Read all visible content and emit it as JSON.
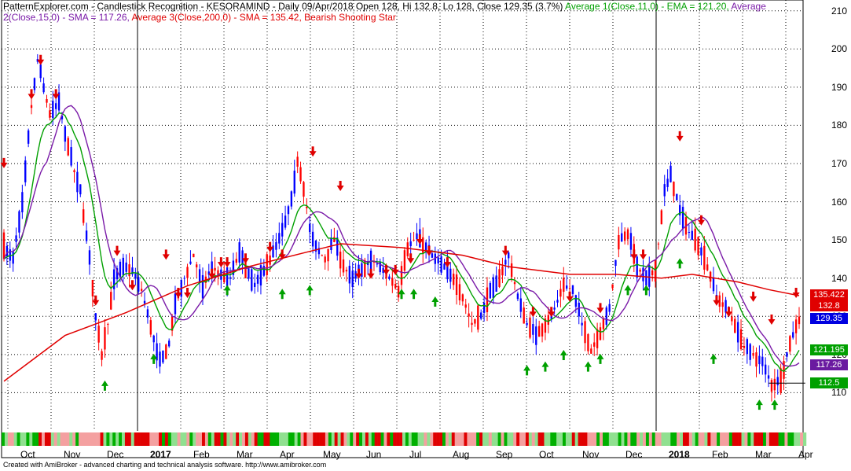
{
  "header": {
    "site": "PatternExplorer.com",
    "rest_black": " - Candlestick Recognition - KESORAMIND - Daily 09/Apr/2018 Open 128, Hi 132.8, Lo 128, Close 129.35 (3.7%) ",
    "avg1": "Average 1(Close,11,0) - EMA = 121.20,",
    "avg2": " Average 2(Close,15,0) - SMA = 117.26,",
    "avg3": " Average 3(Close,200,0) - SMA = 135.42,",
    "pattern": " Bearish Shooting Star"
  },
  "footer": "Created with AmiBroker - advanced charting and technical analysis software. http://www.amibroker.com",
  "colors": {
    "avg1": "#00a000",
    "avg2": "#7a1aa8",
    "avg3": "#e00000",
    "up_candle": "#0000ff",
    "down_candle": "#ff0000",
    "bull_arrow": "#00a000",
    "bear_arrow": "#e00000",
    "grid": "#000000"
  },
  "chart_data": {
    "type": "candlestick",
    "symbol": "KESORAMIND",
    "ylim": [
      100,
      212
    ],
    "y_ticks": [
      110,
      120,
      130,
      140,
      150,
      160,
      170,
      180,
      190,
      200,
      210
    ],
    "x_ticks": [
      {
        "label": "Oct",
        "bold": false
      },
      {
        "label": "Nov",
        "bold": false
      },
      {
        "label": "Dec",
        "bold": false
      },
      {
        "label": "2017",
        "bold": true
      },
      {
        "label": "Feb",
        "bold": false
      },
      {
        "label": "Mar",
        "bold": false
      },
      {
        "label": "Apr",
        "bold": false
      },
      {
        "label": "May",
        "bold": false
      },
      {
        "label": "Jun",
        "bold": false
      },
      {
        "label": "Jul",
        "bold": false
      },
      {
        "label": "Aug",
        "bold": false
      },
      {
        "label": "Sep",
        "bold": false
      },
      {
        "label": "Oct",
        "bold": false
      },
      {
        "label": "Nov",
        "bold": false
      },
      {
        "label": "Dec",
        "bold": false
      },
      {
        "label": "2018",
        "bold": true
      },
      {
        "label": "Feb",
        "bold": false
      },
      {
        "label": "Mar",
        "bold": false
      },
      {
        "label": "Apr",
        "bold": false
      }
    ],
    "price_path": [
      [
        0,
        148
      ],
      [
        3,
        145
      ],
      [
        6,
        160
      ],
      [
        9,
        185
      ],
      [
        11,
        197
      ],
      [
        13,
        190
      ],
      [
        15,
        183
      ],
      [
        18,
        186
      ],
      [
        20,
        178
      ],
      [
        23,
        168
      ],
      [
        25,
        163
      ],
      [
        28,
        145
      ],
      [
        30,
        130
      ],
      [
        32,
        120
      ],
      [
        34,
        128
      ],
      [
        36,
        140
      ],
      [
        39,
        143
      ],
      [
        42,
        142
      ],
      [
        45,
        137
      ],
      [
        48,
        127
      ],
      [
        51,
        118
      ],
      [
        54,
        123
      ],
      [
        56,
        133
      ],
      [
        59,
        140
      ],
      [
        62,
        146
      ],
      [
        65,
        138
      ],
      [
        68,
        143
      ],
      [
        71,
        141
      ],
      [
        74,
        140
      ],
      [
        77,
        147
      ],
      [
        79,
        143
      ],
      [
        82,
        138
      ],
      [
        85,
        142
      ],
      [
        87,
        145
      ],
      [
        90,
        150
      ],
      [
        92,
        155
      ],
      [
        94,
        160
      ],
      [
        96,
        171
      ],
      [
        98,
        164
      ],
      [
        100,
        153
      ],
      [
        102,
        148
      ],
      [
        105,
        145
      ],
      [
        108,
        150
      ],
      [
        111,
        143
      ],
      [
        114,
        140
      ],
      [
        117,
        142
      ],
      [
        120,
        145
      ],
      [
        123,
        143
      ],
      [
        126,
        140
      ],
      [
        129,
        137
      ],
      [
        132,
        148
      ],
      [
        135,
        151
      ],
      [
        138,
        148
      ],
      [
        141,
        145
      ],
      [
        144,
        143
      ],
      [
        147,
        140
      ],
      [
        150,
        135
      ],
      [
        153,
        128
      ],
      [
        156,
        130
      ],
      [
        159,
        136
      ],
      [
        162,
        140
      ],
      [
        165,
        146
      ],
      [
        168,
        135
      ],
      [
        171,
        128
      ],
      [
        174,
        125
      ],
      [
        177,
        128
      ],
      [
        180,
        132
      ],
      [
        183,
        138
      ],
      [
        186,
        137
      ],
      [
        189,
        128
      ],
      [
        192,
        121
      ],
      [
        195,
        126
      ],
      [
        198,
        132
      ],
      [
        201,
        150
      ],
      [
        204,
        152
      ],
      [
        207,
        143
      ],
      [
        210,
        140
      ],
      [
        213,
        142
      ],
      [
        216,
        163
      ],
      [
        218,
        167
      ],
      [
        221,
        158
      ],
      [
        224,
        152
      ],
      [
        227,
        149
      ],
      [
        230,
        143
      ],
      [
        233,
        135
      ],
      [
        236,
        132
      ],
      [
        239,
        128
      ],
      [
        242,
        122
      ],
      [
        245,
        120
      ],
      [
        248,
        118
      ],
      [
        251,
        112
      ],
      [
        254,
        113
      ],
      [
        256,
        120
      ],
      [
        258,
        125
      ],
      [
        260,
        129.35
      ]
    ],
    "avg3_path": [
      [
        0,
        113
      ],
      [
        20,
        125
      ],
      [
        40,
        131
      ],
      [
        60,
        138
      ],
      [
        80,
        143
      ],
      [
        100,
        147
      ],
      [
        110,
        149
      ],
      [
        130,
        148
      ],
      [
        150,
        146
      ],
      [
        165,
        143
      ],
      [
        185,
        141
      ],
      [
        200,
        141
      ],
      [
        215,
        140
      ],
      [
        225,
        141
      ],
      [
        240,
        139
      ],
      [
        250,
        137
      ],
      [
        260,
        135.42
      ]
    ],
    "bear_arrows": [
      [
        0,
        169
      ],
      [
        9,
        187
      ],
      [
        12,
        196
      ],
      [
        17,
        187
      ],
      [
        30,
        133
      ],
      [
        37,
        146
      ],
      [
        42,
        137
      ],
      [
        53,
        145
      ],
      [
        57,
        135
      ],
      [
        60,
        135
      ],
      [
        68,
        140
      ],
      [
        71,
        143
      ],
      [
        73,
        143
      ],
      [
        79,
        144
      ],
      [
        87,
        147
      ],
      [
        91,
        145
      ],
      [
        101,
        172
      ],
      [
        110,
        163
      ],
      [
        116,
        140
      ],
      [
        120,
        140
      ],
      [
        125,
        141
      ],
      [
        128,
        141
      ],
      [
        133,
        144
      ],
      [
        136,
        149
      ],
      [
        139,
        146
      ],
      [
        145,
        143
      ],
      [
        164,
        146
      ],
      [
        173,
        130
      ],
      [
        179,
        130
      ],
      [
        185,
        134
      ],
      [
        195,
        131
      ],
      [
        206,
        145
      ],
      [
        209,
        145
      ],
      [
        221,
        176
      ],
      [
        228,
        154
      ],
      [
        233,
        133
      ],
      [
        237,
        130
      ],
      [
        245,
        134
      ],
      [
        251,
        128
      ],
      [
        259,
        135
      ]
    ],
    "bull_arrows": [
      [
        33,
        113
      ],
      [
        49,
        120
      ],
      [
        73,
        138
      ],
      [
        91,
        137
      ],
      [
        100,
        138
      ],
      [
        130,
        137
      ],
      [
        134,
        137
      ],
      [
        141,
        135
      ],
      [
        171,
        117
      ],
      [
        177,
        118
      ],
      [
        183,
        121
      ],
      [
        191,
        118
      ],
      [
        195,
        120
      ],
      [
        204,
        138
      ],
      [
        210,
        138
      ],
      [
        221,
        145
      ],
      [
        232,
        120
      ],
      [
        247,
        108
      ],
      [
        252,
        108
      ]
    ],
    "sma": {
      "avg1_latest": 121.2,
      "avg2_latest": 117.26,
      "avg3_latest": 135.42
    }
  },
  "badges": [
    {
      "text": "135.422",
      "bg": "#e00000",
      "value": 135.422
    },
    {
      "text": "132.8",
      "bg": "#e00000",
      "value": 132.8
    },
    {
      "text": "129.35",
      "bg": "#0000e0",
      "value": 129.35
    },
    {
      "text": "121.195",
      "bg": "#00a000",
      "value": 121.195
    },
    {
      "text": "117.26",
      "bg": "#6a1aa0",
      "value": 117.26
    },
    {
      "text": "112.5",
      "bg": "#00a000",
      "value": 112.5
    }
  ]
}
